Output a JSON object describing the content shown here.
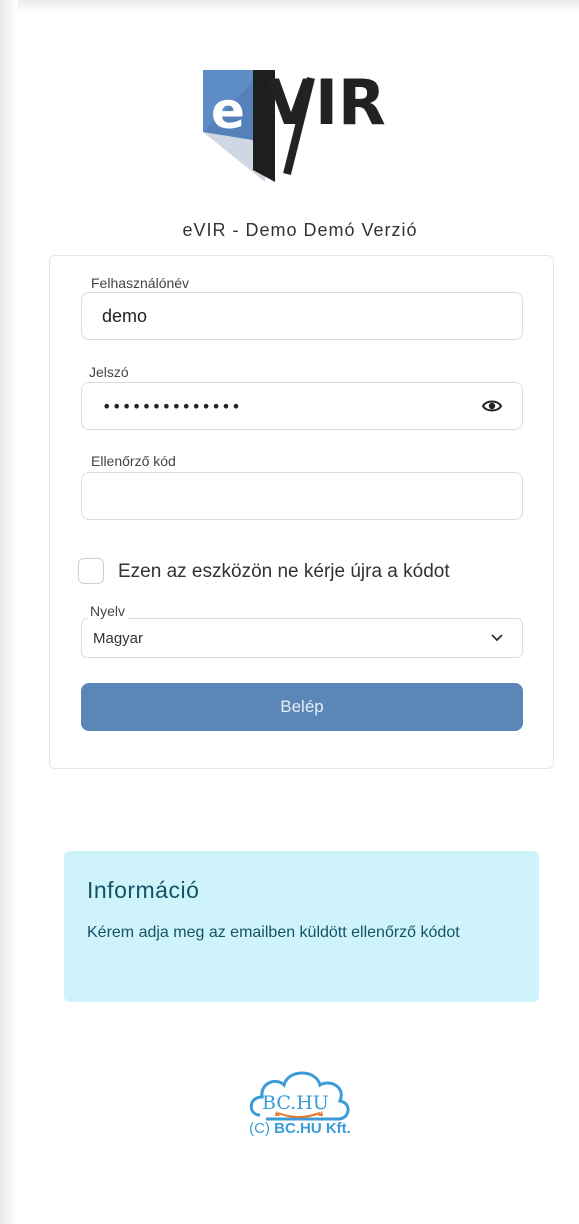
{
  "header": {
    "app_title": "eVIR - Demo Demó Verzió",
    "logo_text": "eVIR"
  },
  "form": {
    "username_label": "Felhasználónév",
    "username_value": "demo",
    "password_label": "Jelszó",
    "password_masked": "••••••••••••••",
    "verification_label": "Ellenőrző kód",
    "verification_value": "",
    "remember_label": "Ezen az eszközön ne kérje újra a kódot",
    "remember_checked": false,
    "language_label": "Nyelv",
    "language_value": "Magyar",
    "login_label": "Belép"
  },
  "info": {
    "title": "Információ",
    "text": "Kérem adja meg az emailben küldött ellenőrző kódot"
  },
  "footer": {
    "logo_text": "BC.HU",
    "copyright_prefix": "(C)",
    "copyright_company": "BC.HU Kft."
  },
  "colors": {
    "accent": "#5b86b8",
    "info_background": "#cff3fb",
    "info_text": "#145366",
    "footer_blue": "#3a9cd8",
    "footer_orange": "#e8762c"
  },
  "icons": [
    "evir-logo",
    "eye-icon",
    "chevron-down-icon",
    "bchu-cloud-logo"
  ]
}
